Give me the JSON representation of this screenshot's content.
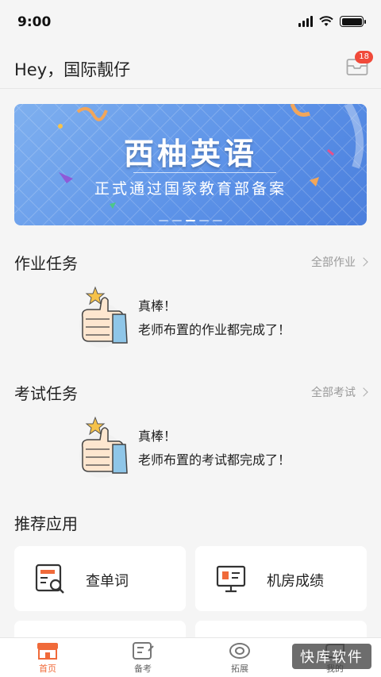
{
  "status_bar": {
    "time": "9:00",
    "battery_level": 1.0
  },
  "header": {
    "greeting": "Hey，国际靓仔",
    "mail_icon": "mail-icon",
    "unread_count": "18"
  },
  "banner": {
    "title": "西柚英语",
    "subtitle": "正式通过国家教育部备案",
    "page_count": 5,
    "active_page": 3,
    "colors": {
      "start": "#7fb0ef",
      "end": "#4b7fdd"
    }
  },
  "homework": {
    "title": "作业任务",
    "more_label": "全部作业",
    "empty_line1": "真棒！",
    "empty_line2": "老师布置的作业都完成了！"
  },
  "exam": {
    "title": "考试任务",
    "more_label": "全部考试",
    "empty_line1": "真棒！",
    "empty_line2": "老师布置的考试都完成了！"
  },
  "recommended": {
    "title": "推荐应用",
    "apps": [
      {
        "label": "查单词",
        "icon": "dictionary-search-icon"
      },
      {
        "label": "机房成绩",
        "icon": "computer-lab-score-icon"
      }
    ]
  },
  "tabbar": {
    "tabs": [
      {
        "label": "首页",
        "icon": "home-icon",
        "active": true
      },
      {
        "label": "备考",
        "icon": "exam-prep-icon",
        "active": false
      },
      {
        "label": "拓展",
        "icon": "explore-icon",
        "active": false
      },
      {
        "label": "我的",
        "icon": "profile-icon",
        "active": false
      }
    ]
  },
  "watermark": "快库软件",
  "colors": {
    "accent": "#f06a3a",
    "badge": "#f04a3a",
    "background": "#f5f5f5"
  }
}
